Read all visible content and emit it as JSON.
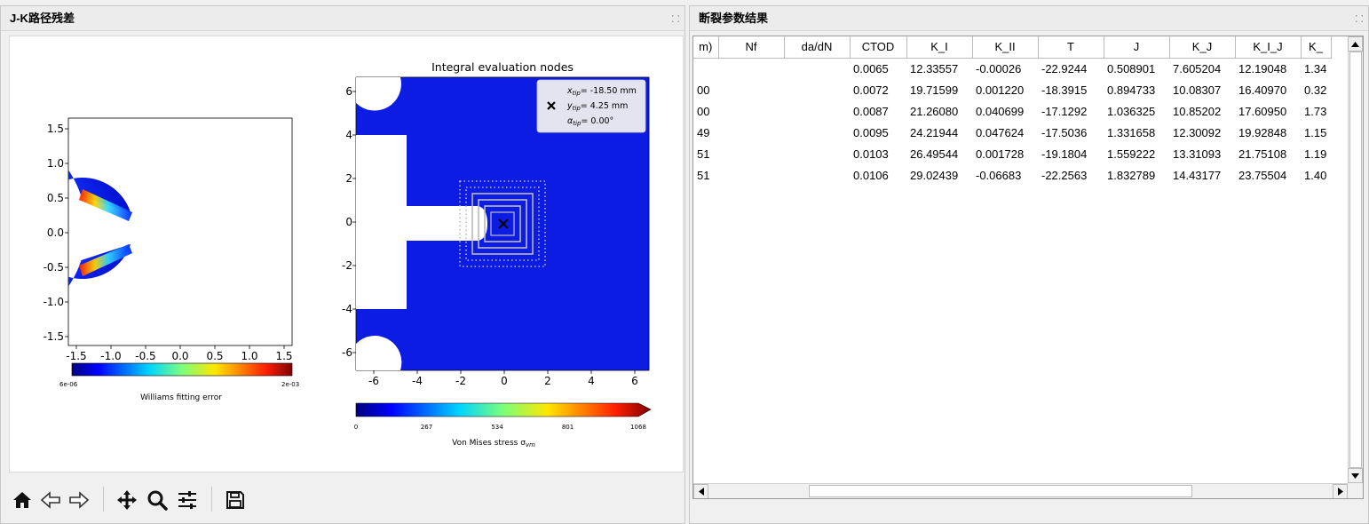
{
  "left_panel": {
    "title": "J-K路径残差",
    "plot_left": {
      "yticks": [
        "1.5",
        "1.0",
        "0.5",
        "0.0",
        "-0.5",
        "-1.0",
        "-1.5"
      ],
      "xticks": [
        "-1.5",
        "-1.0",
        "-0.5",
        "0.0",
        "0.5",
        "1.0",
        "1.5"
      ],
      "cbar_min": "6e-06",
      "cbar_max": "2e-03",
      "cbar_label": "Williams fitting error"
    },
    "plot_right": {
      "title": "Integral evaluation nodes",
      "yticks": [
        "6",
        "4",
        "2",
        "0",
        "-2",
        "-4",
        "-6"
      ],
      "xticks": [
        "-6",
        "-4",
        "-2",
        "0",
        "2",
        "4",
        "6"
      ],
      "legend": {
        "x_tip": "= -18.50 mm",
        "y_tip": "= 4.25 mm",
        "a_tip": "= 0.00°"
      },
      "cbar_ticks": [
        "0",
        "267",
        "534",
        "801",
        "1068"
      ],
      "cbar_label": "Von Mises stress σ",
      "cbar_label_sub": "vm"
    },
    "toolbar_icons": [
      "home-icon",
      "back-arrow-icon",
      "forward-arrow-icon",
      "pan-icon",
      "zoom-icon",
      "configure-icon",
      "save-icon"
    ]
  },
  "right_panel": {
    "title": "断裂参数结果",
    "table": {
      "headers": [
        "m)",
        "Nf",
        "da/dN",
        "CTOD",
        "K_I",
        "K_II",
        "T",
        "J",
        "K_J",
        "K_I_J",
        "K_"
      ],
      "rows": [
        [
          "",
          "",
          "",
          "0.0065",
          "12.33557",
          "-0.00026 ",
          "-22.9244 ",
          "0.508901",
          "7.605204",
          "12.19048",
          "1.34"
        ],
        [
          "00",
          "",
          "",
          "0.0072",
          "19.71599",
          "0.001220",
          "-18.3915 ",
          "0.894733",
          "10.08307",
          "16.40970",
          "0.32"
        ],
        [
          "00",
          "",
          "",
          "0.0087",
          "21.26080",
          "0.040699",
          "-17.1292 ",
          "1.036325",
          "10.85202",
          "17.60950",
          "1.73"
        ],
        [
          "49",
          "",
          "",
          "0.0095",
          "24.21944",
          "0.047624",
          "-17.5036 ",
          "1.331658",
          "12.30092",
          "19.92848",
          "1.15"
        ],
        [
          "51",
          "",
          "",
          "0.0103",
          "26.49544",
          "0.001728",
          "-19.1804 ",
          "1.559222",
          "13.31093",
          "21.75108",
          "1.19"
        ],
        [
          "51",
          "",
          "",
          "0.0106",
          "29.02439",
          "-0.06683 ",
          "-22.2563 ",
          "1.832789",
          "14.43177",
          "23.75504",
          "1.40"
        ]
      ]
    }
  }
}
